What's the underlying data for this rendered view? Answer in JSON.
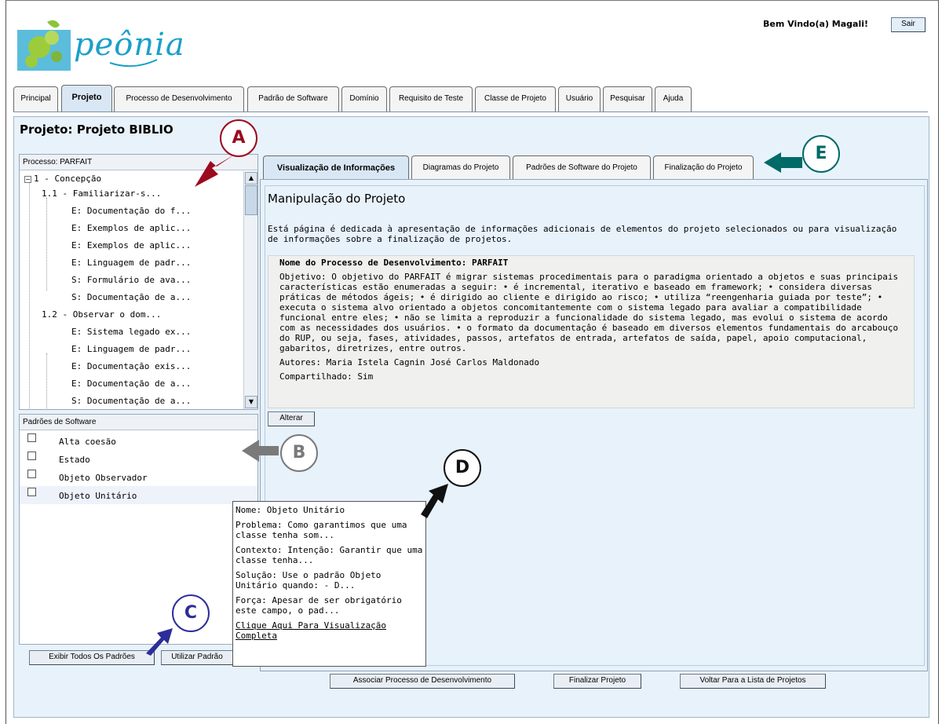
{
  "logo": {
    "text": "peônia"
  },
  "header": {
    "welcome": "Bem Vindo(a) Magali!",
    "logout": "Sair"
  },
  "main_tabs": [
    "Principal",
    "Projeto",
    "Processo de Desenvolvimento",
    "Padrão de Software",
    "Domínio",
    "Requisito de Teste",
    "Classe de Projeto",
    "Usuário",
    "Pesquisar",
    "Ajuda"
  ],
  "project": {
    "title": "Projeto: Projeto BIBLIO"
  },
  "process_tree": {
    "header": "Processo: PARFAIT",
    "items": [
      "1 - Concepção",
      "1.1 - Familiarizar-s...",
      "E: Documentação do f...",
      "E: Exemplos de aplic...",
      "E: Exemplos de aplic...",
      "E: Linguagem de padr...",
      "S: Formulário de ava...",
      "S: Documentação de a...",
      "1.2 - Observar o dom...",
      "E: Sistema legado ex...",
      "E: Linguagem de padr...",
      "E: Documentação exis...",
      "E: Documentação de a...",
      "S: Documentação de a..."
    ]
  },
  "patterns": {
    "header": "Padrões de Software",
    "items": [
      "Alta coesão",
      "Estado",
      "Objeto Observador",
      "Objeto Unitário"
    ],
    "show_all": "Exibir Todos Os Padrões",
    "use": "Utilizar Padrão"
  },
  "inner_tabs": [
    "Visualização de Informações",
    "Diagramas do Projeto",
    "Padrões de Software do Projeto",
    "Finalização do Projeto"
  ],
  "content": {
    "title": "Manipulação do Projeto",
    "description": "Está página é dedicada à apresentação de informações adicionais de elementos do projeto selecionados ou para visualização de informações sobre a finalização de projetos.",
    "process_name": "Nome do Processo de Desenvolvimento: PARFAIT",
    "objective": "Objetivo: O objetivo do PARFAIT é migrar sistemas procedimentais para o paradigma orientado a objetos e suas principais características estão enumeradas a seguir: • é incremental, iterativo e baseado em framework; • considera diversas práticas de métodos ágeis; • é dirigido ao cliente e dirigido ao risco; • utiliza “reengenharia guiada por teste”; • executa o sistema alvo orientado a objetos concomitantemente com o sistema legado para avaliar a compatibilidade funcional entre eles; • não se limita a reproduzir a funcionalidade do sistema legado, mas evolui o sistema de acordo com as necessidades dos usuários. • o formato da documentaçâo é baseado em diversos elementos fundamentais do arcabouço do RUP, ou seja, fases, atividades, passos, artefatos de entrada, artefatos de saída, papel, apoio computacional, gabaritos, diretrizes, entre outros.",
    "authors": "Autores: Maria Istela Cagnin José Carlos Maldonado",
    "shared": "Compartilhado: Sim",
    "edit": "Alterar"
  },
  "footer": {
    "associate": "Associar Processo de Desenvolvimento",
    "finalize": "Finalizar Projeto",
    "back": "Voltar Para a Lista de Projetos"
  },
  "tooltip": {
    "name": "Nome: Objeto Unitário",
    "problem": "Problema: Como garantimos que uma classe tenha som...",
    "context": "Contexto: Intenção: Garantir que uma classe tenha...",
    "solution": "Solução: Use o padrão Objeto Unitário quando: - D...",
    "force": "Força: Apesar de ser obrigatório este campo, o pad...",
    "link": "Clique Aqui Para Visualização Completa"
  },
  "annotations": {
    "a": "A",
    "b": "B",
    "c": "C",
    "d": "D",
    "e": "E"
  },
  "colors": {
    "panel_bg": "#e8f2fb",
    "arrow_a": "#9b0a1e",
    "arrow_b": "#7a7a7a",
    "arrow_c": "#2d2d9a",
    "arrow_d": "#111111",
    "arrow_e": "#006a66"
  }
}
